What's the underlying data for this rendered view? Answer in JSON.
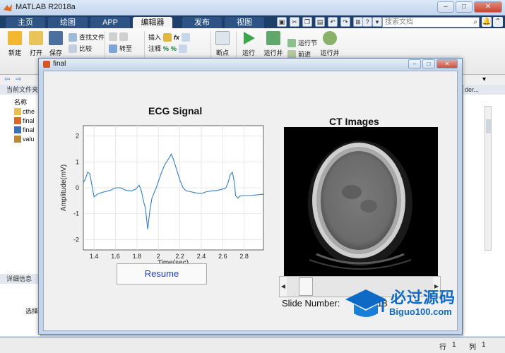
{
  "app": {
    "title": "MATLAB R2018a"
  },
  "tabs": [
    "主页",
    "绘图",
    "APP",
    "编辑器",
    "发布",
    "视图"
  ],
  "active_tab": "编辑器",
  "search": {
    "placeholder": "搜索文档"
  },
  "ribbon": {
    "new": "新建",
    "open": "打开",
    "save": "保存",
    "find_files": "查找文件",
    "compare": "比较",
    "goto": "转至",
    "insert": "插入",
    "comment": "注释",
    "breakpoint": "断点",
    "run": "运行",
    "run_advance": "运行并",
    "run_section": "运行节",
    "advance": "前进",
    "run_time": "运行并"
  },
  "left_panel": {
    "header": "当前文件夹",
    "column": "名称",
    "files": [
      "cthe",
      "final",
      "final",
      "valu"
    ],
    "detail_header": "详细信息",
    "detail_text": "选择"
  },
  "right_panel": {
    "header": "der..."
  },
  "status": {
    "row_label": "行",
    "row_value": "1",
    "col_label": "列",
    "col_value": "1"
  },
  "figure": {
    "title": "final",
    "ecg_title": "ECG Signal",
    "ecg_xlabel": "Time(sec)",
    "ecg_ylabel": "Amplitude(mV)",
    "resume_label": "Resume",
    "ct_title": "CT Images",
    "slide_label": "Slide Number:",
    "slide_value": "18",
    "slider_position": 0.09
  },
  "watermark": {
    "cn": "必过源码",
    "en": "Biguo100.com"
  },
  "chart_data": {
    "type": "line",
    "title": "ECG Signal",
    "xlabel": "Time(sec)",
    "ylabel": "Amplitude(mV)",
    "xlim": [
      1.3,
      2.98
    ],
    "ylim": [
      -2.4,
      2.4
    ],
    "xticks": [
      1.4,
      1.6,
      1.8,
      2.0,
      2.2,
      2.4,
      2.6,
      2.8
    ],
    "xtick_labels": [
      "1.4",
      "1.6",
      "1.8",
      "2",
      "2.2",
      "2.4",
      "2.6",
      "2.8"
    ],
    "yticks": [
      -2,
      -1,
      0,
      1,
      2
    ],
    "ytick_labels": [
      "-2",
      "-1",
      "0",
      "1",
      "2"
    ],
    "grid": true,
    "color": "#2f7fce",
    "series": [
      {
        "x": [
          1.3,
          1.32,
          1.34,
          1.36,
          1.38,
          1.4,
          1.43,
          1.46,
          1.5,
          1.55,
          1.6,
          1.65,
          1.7,
          1.75,
          1.79,
          1.82,
          1.84,
          1.86,
          1.88,
          1.9,
          1.92,
          1.94,
          1.96,
          1.98,
          2.0,
          2.03,
          2.06,
          2.1,
          2.12,
          2.14,
          2.17,
          2.2,
          2.23,
          2.26,
          2.3,
          2.35,
          2.4,
          2.45,
          2.5,
          2.55,
          2.6,
          2.63,
          2.65,
          2.67,
          2.69,
          2.71,
          2.72,
          2.74,
          2.76,
          2.8,
          2.85,
          2.9,
          2.95,
          2.98
        ],
        "y": [
          0.2,
          0.35,
          0.6,
          0.55,
          0.1,
          -0.35,
          -0.25,
          -0.2,
          -0.15,
          -0.1,
          0.0,
          0.0,
          -0.1,
          -0.12,
          -0.05,
          0.1,
          -0.1,
          -0.5,
          -0.8,
          -1.6,
          -0.9,
          -0.4,
          -0.2,
          0.0,
          0.25,
          0.6,
          0.9,
          1.15,
          1.3,
          1.1,
          0.7,
          0.3,
          0.0,
          -0.12,
          -0.15,
          -0.2,
          -0.22,
          -0.15,
          -0.12,
          -0.1,
          -0.05,
          0.0,
          0.2,
          0.5,
          0.6,
          0.2,
          -0.3,
          -0.4,
          -0.32,
          -0.3,
          -0.3,
          -0.28,
          -0.26,
          -0.25
        ]
      }
    ]
  }
}
